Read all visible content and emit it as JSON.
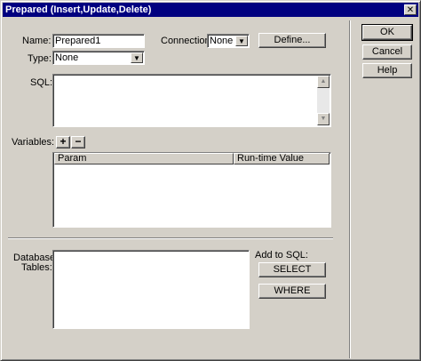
{
  "window": {
    "title": "Prepared (Insert,Update,Delete)",
    "close_glyph": "✕"
  },
  "form": {
    "name_label": "Name:",
    "name_value": "Prepared1",
    "connection_label": "Connection:",
    "connection_value": "None",
    "define_button": "Define...",
    "type_label": "Type:",
    "type_value": "None",
    "sql_label": "SQL:",
    "sql_value": "",
    "variables_label": "Variables:",
    "add_variable_glyph": "+",
    "remove_variable_glyph": "−",
    "variables_table": {
      "columns": [
        "Param",
        "Run-time Value"
      ],
      "rows": []
    },
    "database_tables_label_line1": "Database",
    "database_tables_label_line2": "Tables:",
    "add_to_sql_label": "Add to SQL:",
    "select_button": "SELECT",
    "where_button": "WHERE"
  },
  "side_buttons": {
    "ok": "OK",
    "cancel": "Cancel",
    "help": "Help"
  },
  "icons": {
    "dropdown_arrow": "▼",
    "scroll_up": "▲",
    "scroll_down": "▼",
    "close": "close-icon"
  }
}
